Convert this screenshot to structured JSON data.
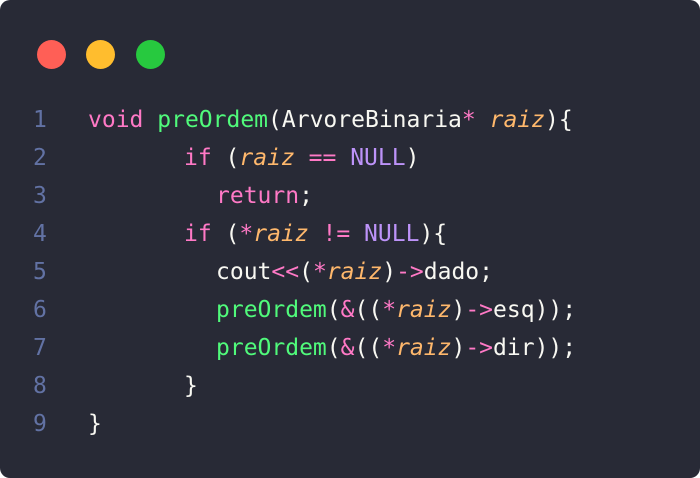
{
  "window": {
    "controls": [
      {
        "name": "close-dot",
        "color": "#ff5f56"
      },
      {
        "name": "minimize-dot",
        "color": "#ffbd2e"
      },
      {
        "name": "maximize-dot",
        "color": "#27c93f"
      }
    ]
  },
  "code": {
    "lines": [
      {
        "number": "1",
        "indent": 88,
        "tokens": [
          {
            "t": "void ",
            "k": "keyword"
          },
          {
            "t": "preOrdem",
            "k": "func"
          },
          {
            "t": "(",
            "k": "punct"
          },
          {
            "t": "ArvoreBinaria",
            "k": "type"
          },
          {
            "t": "* ",
            "k": "op"
          },
          {
            "t": "raiz",
            "k": "param"
          },
          {
            "t": "){",
            "k": "punct"
          }
        ]
      },
      {
        "number": "2",
        "indent": 184,
        "tokens": [
          {
            "t": "if",
            "k": "keyword"
          },
          {
            "t": " (",
            "k": "punct"
          },
          {
            "t": "raiz",
            "k": "param"
          },
          {
            "t": " == ",
            "k": "op"
          },
          {
            "t": "NULL",
            "k": "const"
          },
          {
            "t": ")",
            "k": "punct"
          }
        ]
      },
      {
        "number": "3",
        "indent": 216,
        "tokens": [
          {
            "t": "return",
            "k": "keyword"
          },
          {
            "t": ";",
            "k": "punct"
          }
        ]
      },
      {
        "number": "4",
        "indent": 184,
        "tokens": [
          {
            "t": "if",
            "k": "keyword"
          },
          {
            "t": " (",
            "k": "punct"
          },
          {
            "t": "*",
            "k": "op"
          },
          {
            "t": "raiz",
            "k": "param"
          },
          {
            "t": " != ",
            "k": "op"
          },
          {
            "t": "NULL",
            "k": "const"
          },
          {
            "t": "){",
            "k": "punct"
          }
        ]
      },
      {
        "number": "5",
        "indent": 216,
        "tokens": [
          {
            "t": "cout",
            "k": "ident"
          },
          {
            "t": "<<",
            "k": "op"
          },
          {
            "t": "(",
            "k": "punct"
          },
          {
            "t": "*",
            "k": "op"
          },
          {
            "t": "raiz",
            "k": "param"
          },
          {
            "t": ")",
            "k": "punct"
          },
          {
            "t": "->",
            "k": "op"
          },
          {
            "t": "dado",
            "k": "ident"
          },
          {
            "t": ";",
            "k": "punct"
          }
        ]
      },
      {
        "number": "6",
        "indent": 216,
        "tokens": [
          {
            "t": "preOrdem",
            "k": "func"
          },
          {
            "t": "(",
            "k": "punct"
          },
          {
            "t": "&",
            "k": "op"
          },
          {
            "t": "((",
            "k": "punct"
          },
          {
            "t": "*",
            "k": "op"
          },
          {
            "t": "raiz",
            "k": "param"
          },
          {
            "t": ")",
            "k": "punct"
          },
          {
            "t": "->",
            "k": "op"
          },
          {
            "t": "esq",
            "k": "ident"
          },
          {
            "t": "));",
            "k": "punct"
          }
        ]
      },
      {
        "number": "7",
        "indent": 216,
        "tokens": [
          {
            "t": "preOrdem",
            "k": "func"
          },
          {
            "t": "(",
            "k": "punct"
          },
          {
            "t": "&",
            "k": "op"
          },
          {
            "t": "((",
            "k": "punct"
          },
          {
            "t": "*",
            "k": "op"
          },
          {
            "t": "raiz",
            "k": "param"
          },
          {
            "t": ")",
            "k": "punct"
          },
          {
            "t": "->",
            "k": "op"
          },
          {
            "t": "dir",
            "k": "ident"
          },
          {
            "t": "));",
            "k": "punct"
          }
        ]
      },
      {
        "number": "8",
        "indent": 184,
        "tokens": [
          {
            "t": "}",
            "k": "punct"
          }
        ]
      },
      {
        "number": "9",
        "indent": 88,
        "tokens": [
          {
            "t": "}",
            "k": "punct"
          }
        ]
      }
    ]
  }
}
